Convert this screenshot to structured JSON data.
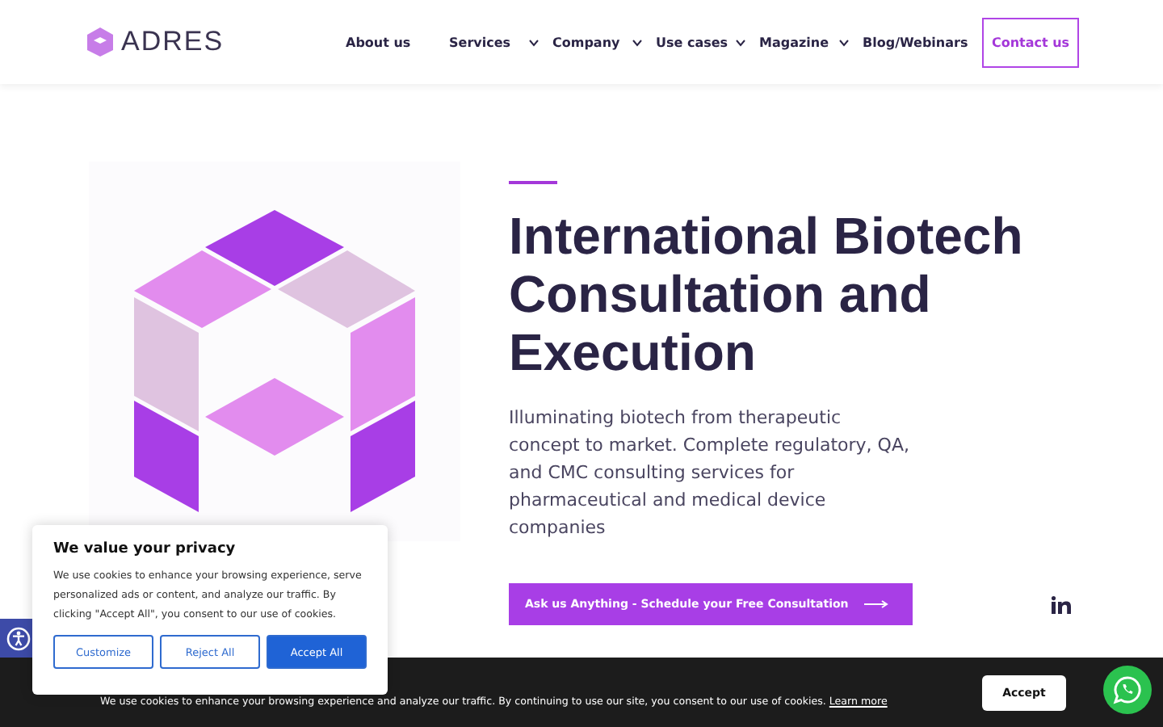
{
  "header": {
    "logo": "ADRES",
    "nav": [
      {
        "label": "About us",
        "dropdown": false
      },
      {
        "label": "Services",
        "dropdown": true
      },
      {
        "label": "Company",
        "dropdown": true
      },
      {
        "label": "Use cases",
        "dropdown": true
      },
      {
        "label": "Magazine",
        "dropdown": true
      },
      {
        "label": "Blog/Webinars",
        "dropdown": false
      }
    ],
    "contact": "Contact us"
  },
  "hero": {
    "title": "International Biotech Consultation and Execution",
    "subtitle": "Illuminating biotech from therapeutic concept to market. Complete regulatory, QA, and CMC consulting services for pharmaceutical and medical device companies",
    "cta": "Ask us Anything - Schedule your Free Consultation"
  },
  "privacy": {
    "title": "We value your privacy",
    "text": "We use cookies to enhance your browsing experience, serve personalized ads or content, and analyze our traffic. By clicking \"Accept All\", you consent to our use of cookies.",
    "buttons": [
      "Customize",
      "Reject All",
      "Accept All"
    ]
  },
  "cookie_bar": {
    "text": "We use cookies to enhance your browsing experience and analyze our traffic. By continuing to use our site, you consent to our use of cookies.",
    "link": "Learn more",
    "button": "Accept"
  }
}
